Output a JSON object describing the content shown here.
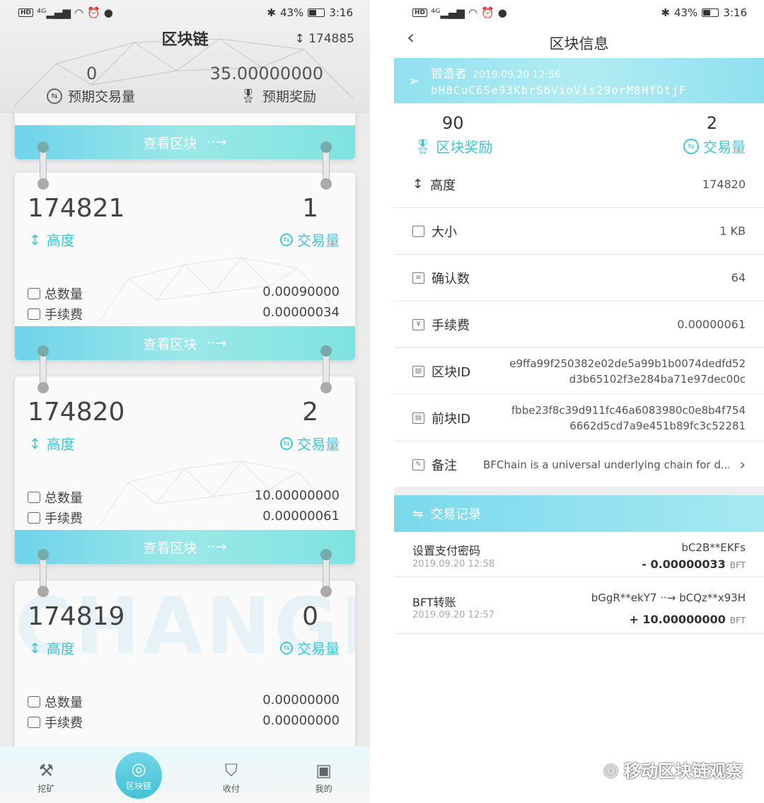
{
  "status_left": {
    "time": "3:16",
    "battery": "43%"
  },
  "status_right": {
    "time": "3:16",
    "battery": "43%"
  },
  "left": {
    "title": "区块链",
    "height_label": "↕ 174885",
    "expected_tx_value": "0",
    "expected_tx_label": "预期交易量",
    "expected_reward_value": "35.00000000",
    "expected_reward_label": "预期奖励",
    "view_block": "查看区块",
    "blocks": [
      {
        "height": "174821",
        "tx": "1",
        "height_label": "高度",
        "tx_label": "交易量",
        "total_label": "总数量",
        "total": "0.00090000",
        "fee_label": "手续费",
        "fee": "0.00000034"
      },
      {
        "height": "174820",
        "tx": "2",
        "height_label": "高度",
        "tx_label": "交易量",
        "total_label": "总数量",
        "total": "10.00000000",
        "fee_label": "手续费",
        "fee": "0.00000061"
      },
      {
        "height": "174819",
        "tx": "0",
        "height_label": "高度",
        "tx_label": "交易量",
        "total_label": "总数量",
        "total": "0.00000000",
        "fee_label": "手续费",
        "fee": "0.00000000"
      }
    ],
    "watermark": "CHANGE",
    "nav": [
      {
        "label": "挖矿",
        "icon": "pickaxe-icon"
      },
      {
        "label": "区块链",
        "icon": "globe-icon"
      },
      {
        "label": "收付",
        "icon": "shield-icon"
      },
      {
        "label": "我的",
        "icon": "wallet-icon"
      }
    ]
  },
  "right": {
    "title": "区块信息",
    "forger_label": "锻造者",
    "forger_time": "2019.09.20 12:56",
    "forger_address": "bH8CuC6Se93KbrS6VioVis29orM8HfDtjF",
    "reward_value": "90",
    "reward_label": "区块奖励",
    "tx_value": "2",
    "tx_label": "交易量",
    "info": [
      {
        "label": "高度",
        "value": "174820"
      },
      {
        "label": "大小",
        "value": "1 KB"
      },
      {
        "label": "确认数",
        "value": "64"
      },
      {
        "label": "手续费",
        "value": "0.00000061"
      },
      {
        "label": "区块ID",
        "value": "e9ffa99f250382e02de5a99b1b0074dedfd52\nd3b65102f3e284ba71e97dec00c"
      },
      {
        "label": "前块ID",
        "value": "fbbe23f8c39d911fc46a6083980c0e8b4f754\n6662d5cd7a9e451b89fc3c52281"
      },
      {
        "label": "备注",
        "value": "BFChain is a universal underlying chain for d..."
      }
    ],
    "tx_records_label": "交易记录",
    "transactions": [
      {
        "type": "设置支付密码",
        "time": "2019.09.20 12:58",
        "address": "bC2B**EKFs",
        "amount": "- 0.00000033",
        "unit": "BFT"
      },
      {
        "type": "BFT转账",
        "time": "2019.09.20 12:57",
        "address": "bGgR**ekY7 ··→ bCQz**x93H",
        "amount": "+ 10.00000000",
        "unit": "BFT"
      }
    ]
  },
  "watermark_wechat": "移动区块链观察"
}
